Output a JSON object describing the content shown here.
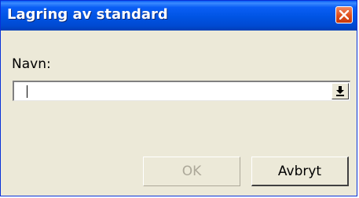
{
  "dialog": {
    "title": "Lagring av standard",
    "field_label": "Navn:",
    "field_value": "",
    "ok_label": "OK",
    "cancel_label": "Avbryt"
  },
  "icons": {
    "close": "close-icon",
    "dropdown": "download-arrow-icon"
  },
  "colors": {
    "titlebar": "#0054e3",
    "close_button": "#e04e1a",
    "face": "#ece9d8",
    "disabled_text": "#aca899"
  }
}
